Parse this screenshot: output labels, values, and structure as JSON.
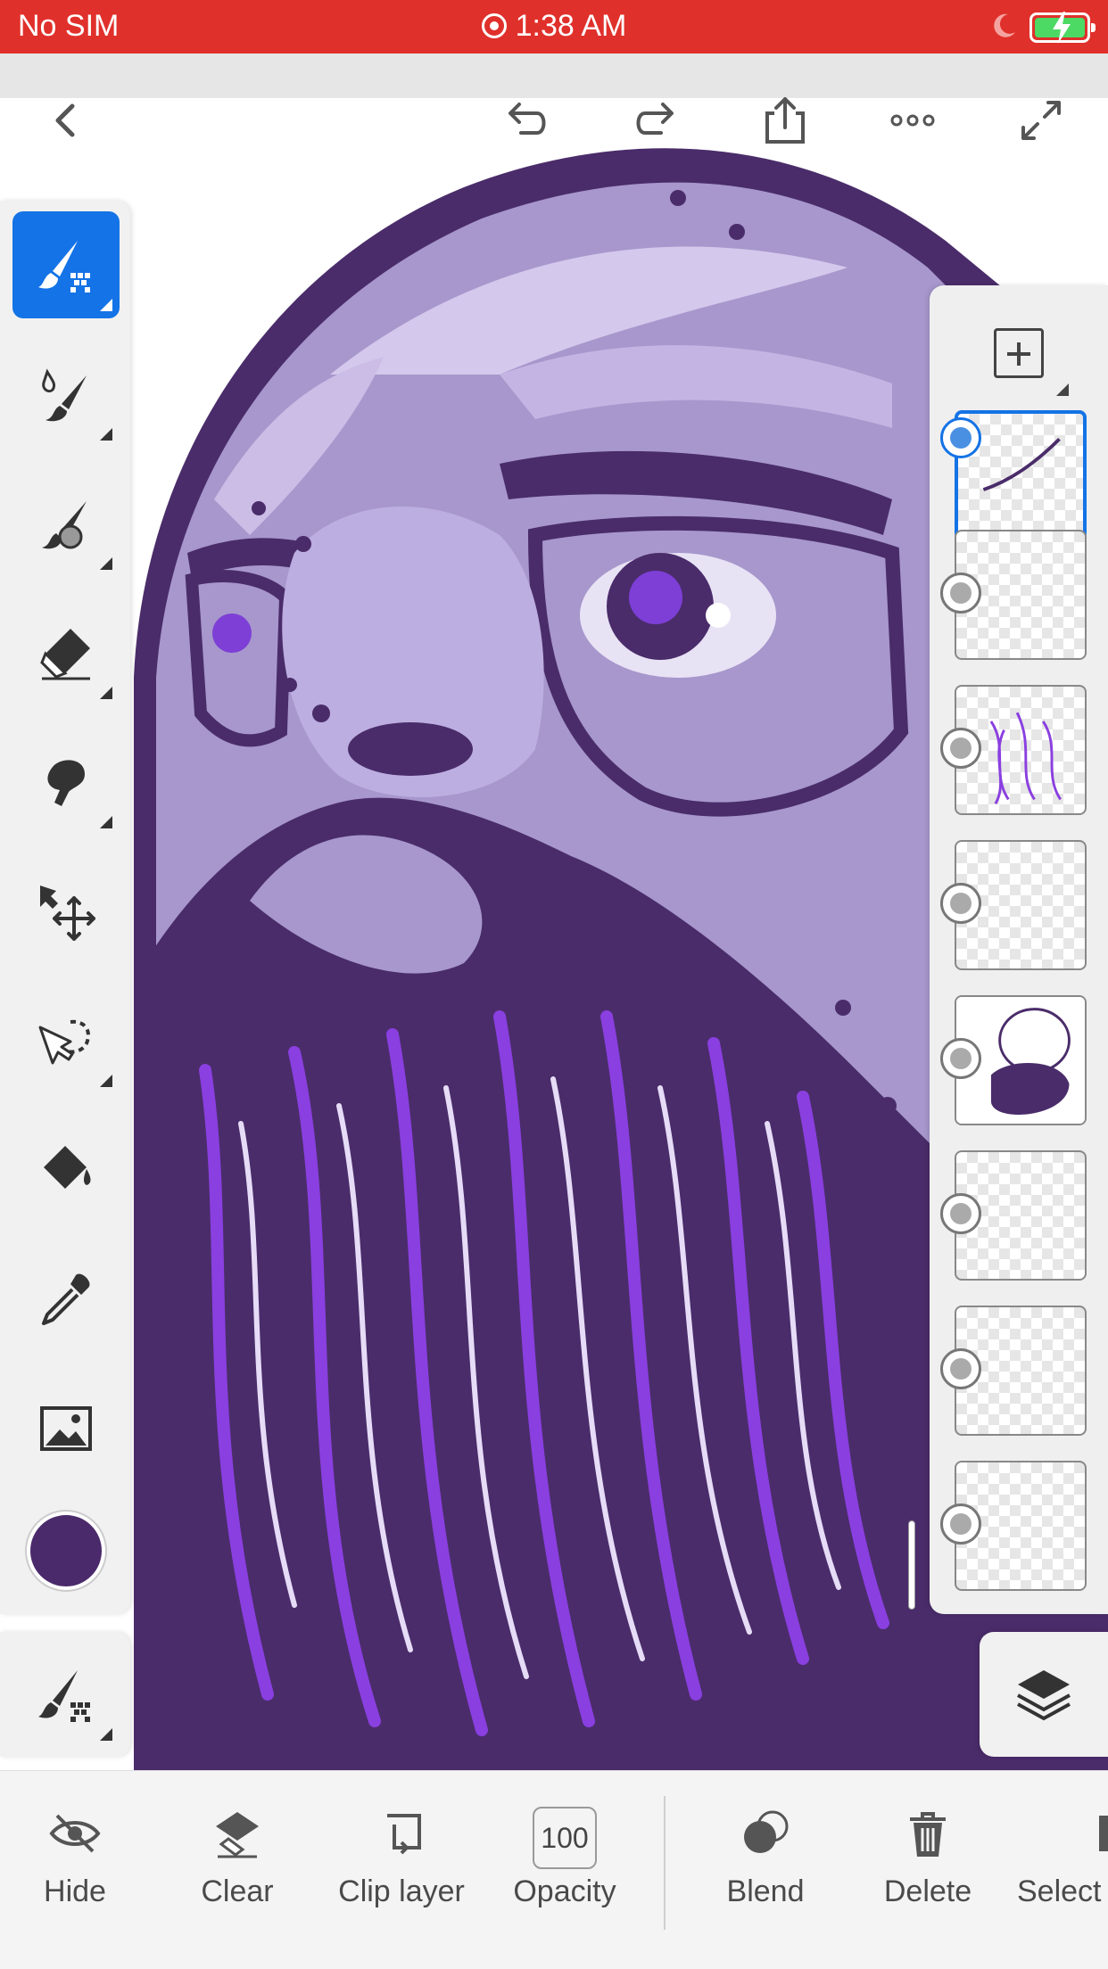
{
  "status_bar": {
    "carrier": "No SIM",
    "time": "1:38 AM",
    "colors": {
      "background": "#e0302b",
      "battery": "#4cd964"
    }
  },
  "top_toolbar": {
    "icons": [
      "back-chevron-icon",
      "undo-icon",
      "redo-icon",
      "share-icon",
      "more-icon",
      "fullscreen-icon"
    ]
  },
  "tools": {
    "icons": [
      "pixel-brush-icon",
      "live-brush-icon",
      "vector-brush-icon",
      "eraser-icon",
      "smudge-icon",
      "transform-icon",
      "lasso-select-icon",
      "fill-icon",
      "eyedropper-icon",
      "image-icon"
    ],
    "active": "pixel-brush-icon",
    "current_color": "#4b2a6b",
    "accent_color": "#1473e6"
  },
  "layers": {
    "count": 8,
    "selected_index": 0,
    "items": [
      {
        "kind": "signature"
      },
      {
        "kind": "empty"
      },
      {
        "kind": "beard-lines"
      },
      {
        "kind": "specks"
      },
      {
        "kind": "portrait"
      },
      {
        "kind": "empty"
      },
      {
        "kind": "empty"
      },
      {
        "kind": "empty"
      }
    ]
  },
  "actions": {
    "hide": "Hide",
    "clear": "Clear",
    "clip_layer": "Clip layer",
    "opacity_value": "100",
    "opacity": "Opacity",
    "blend": "Blend",
    "delete": "Delete",
    "select": "Select"
  }
}
